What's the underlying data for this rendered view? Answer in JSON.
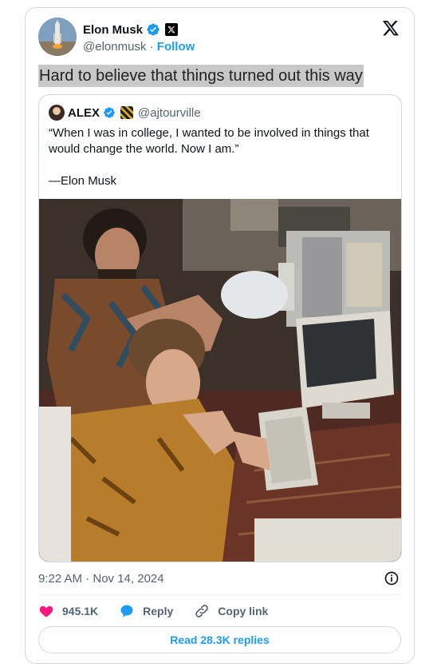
{
  "author": {
    "display_name": "Elon Musk",
    "handle": "@elonmusk",
    "separator": "·",
    "follow_label": "Follow"
  },
  "tweet": {
    "text": "Hard to believe that things turned out this way",
    "time": "9:22 AM · Nov 14, 2024"
  },
  "quoted": {
    "display_name": "ALEX",
    "handle": "@ajtourville",
    "quote_line": "“When I was in college, I wanted to be involved in things that would change the world. Now I am.”",
    "attribution": "—Elon Musk"
  },
  "actions": {
    "likes": "945.1K",
    "reply_label": "Reply",
    "copy_label": "Copy link"
  },
  "replies_button": "Read 28.3K replies",
  "colors": {
    "accent": "#1d9bf0",
    "like": "#f91880",
    "text": "#0f1419",
    "muted": "#536471"
  },
  "icons": [
    "verified-badge-icon",
    "x-affiliate-icon",
    "x-logo-icon",
    "info-icon",
    "heart-icon",
    "reply-bubble-icon",
    "link-icon"
  ]
}
